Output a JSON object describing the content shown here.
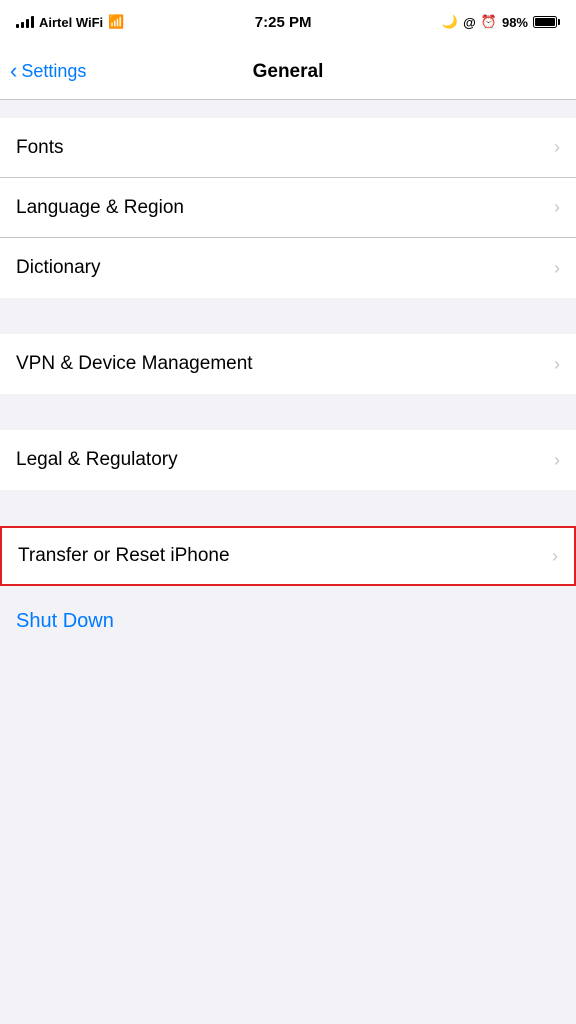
{
  "statusBar": {
    "carrier": "Airtel WiFi",
    "time": "7:25 PM",
    "batteryPercent": "98%"
  },
  "navBar": {
    "backLabel": "Settings",
    "title": "General"
  },
  "settingsGroups": [
    {
      "id": "group1",
      "items": [
        {
          "id": "fonts",
          "label": "Fonts"
        },
        {
          "id": "language-region",
          "label": "Language & Region"
        },
        {
          "id": "dictionary",
          "label": "Dictionary"
        }
      ]
    },
    {
      "id": "group2",
      "items": [
        {
          "id": "vpn-device",
          "label": "VPN & Device Management"
        }
      ]
    },
    {
      "id": "group3",
      "items": [
        {
          "id": "legal-regulatory",
          "label": "Legal & Regulatory"
        }
      ]
    },
    {
      "id": "group4",
      "items": [
        {
          "id": "transfer-reset",
          "label": "Transfer or Reset iPhone",
          "highlighted": true
        }
      ]
    }
  ],
  "shutDown": {
    "label": "Shut Down"
  }
}
